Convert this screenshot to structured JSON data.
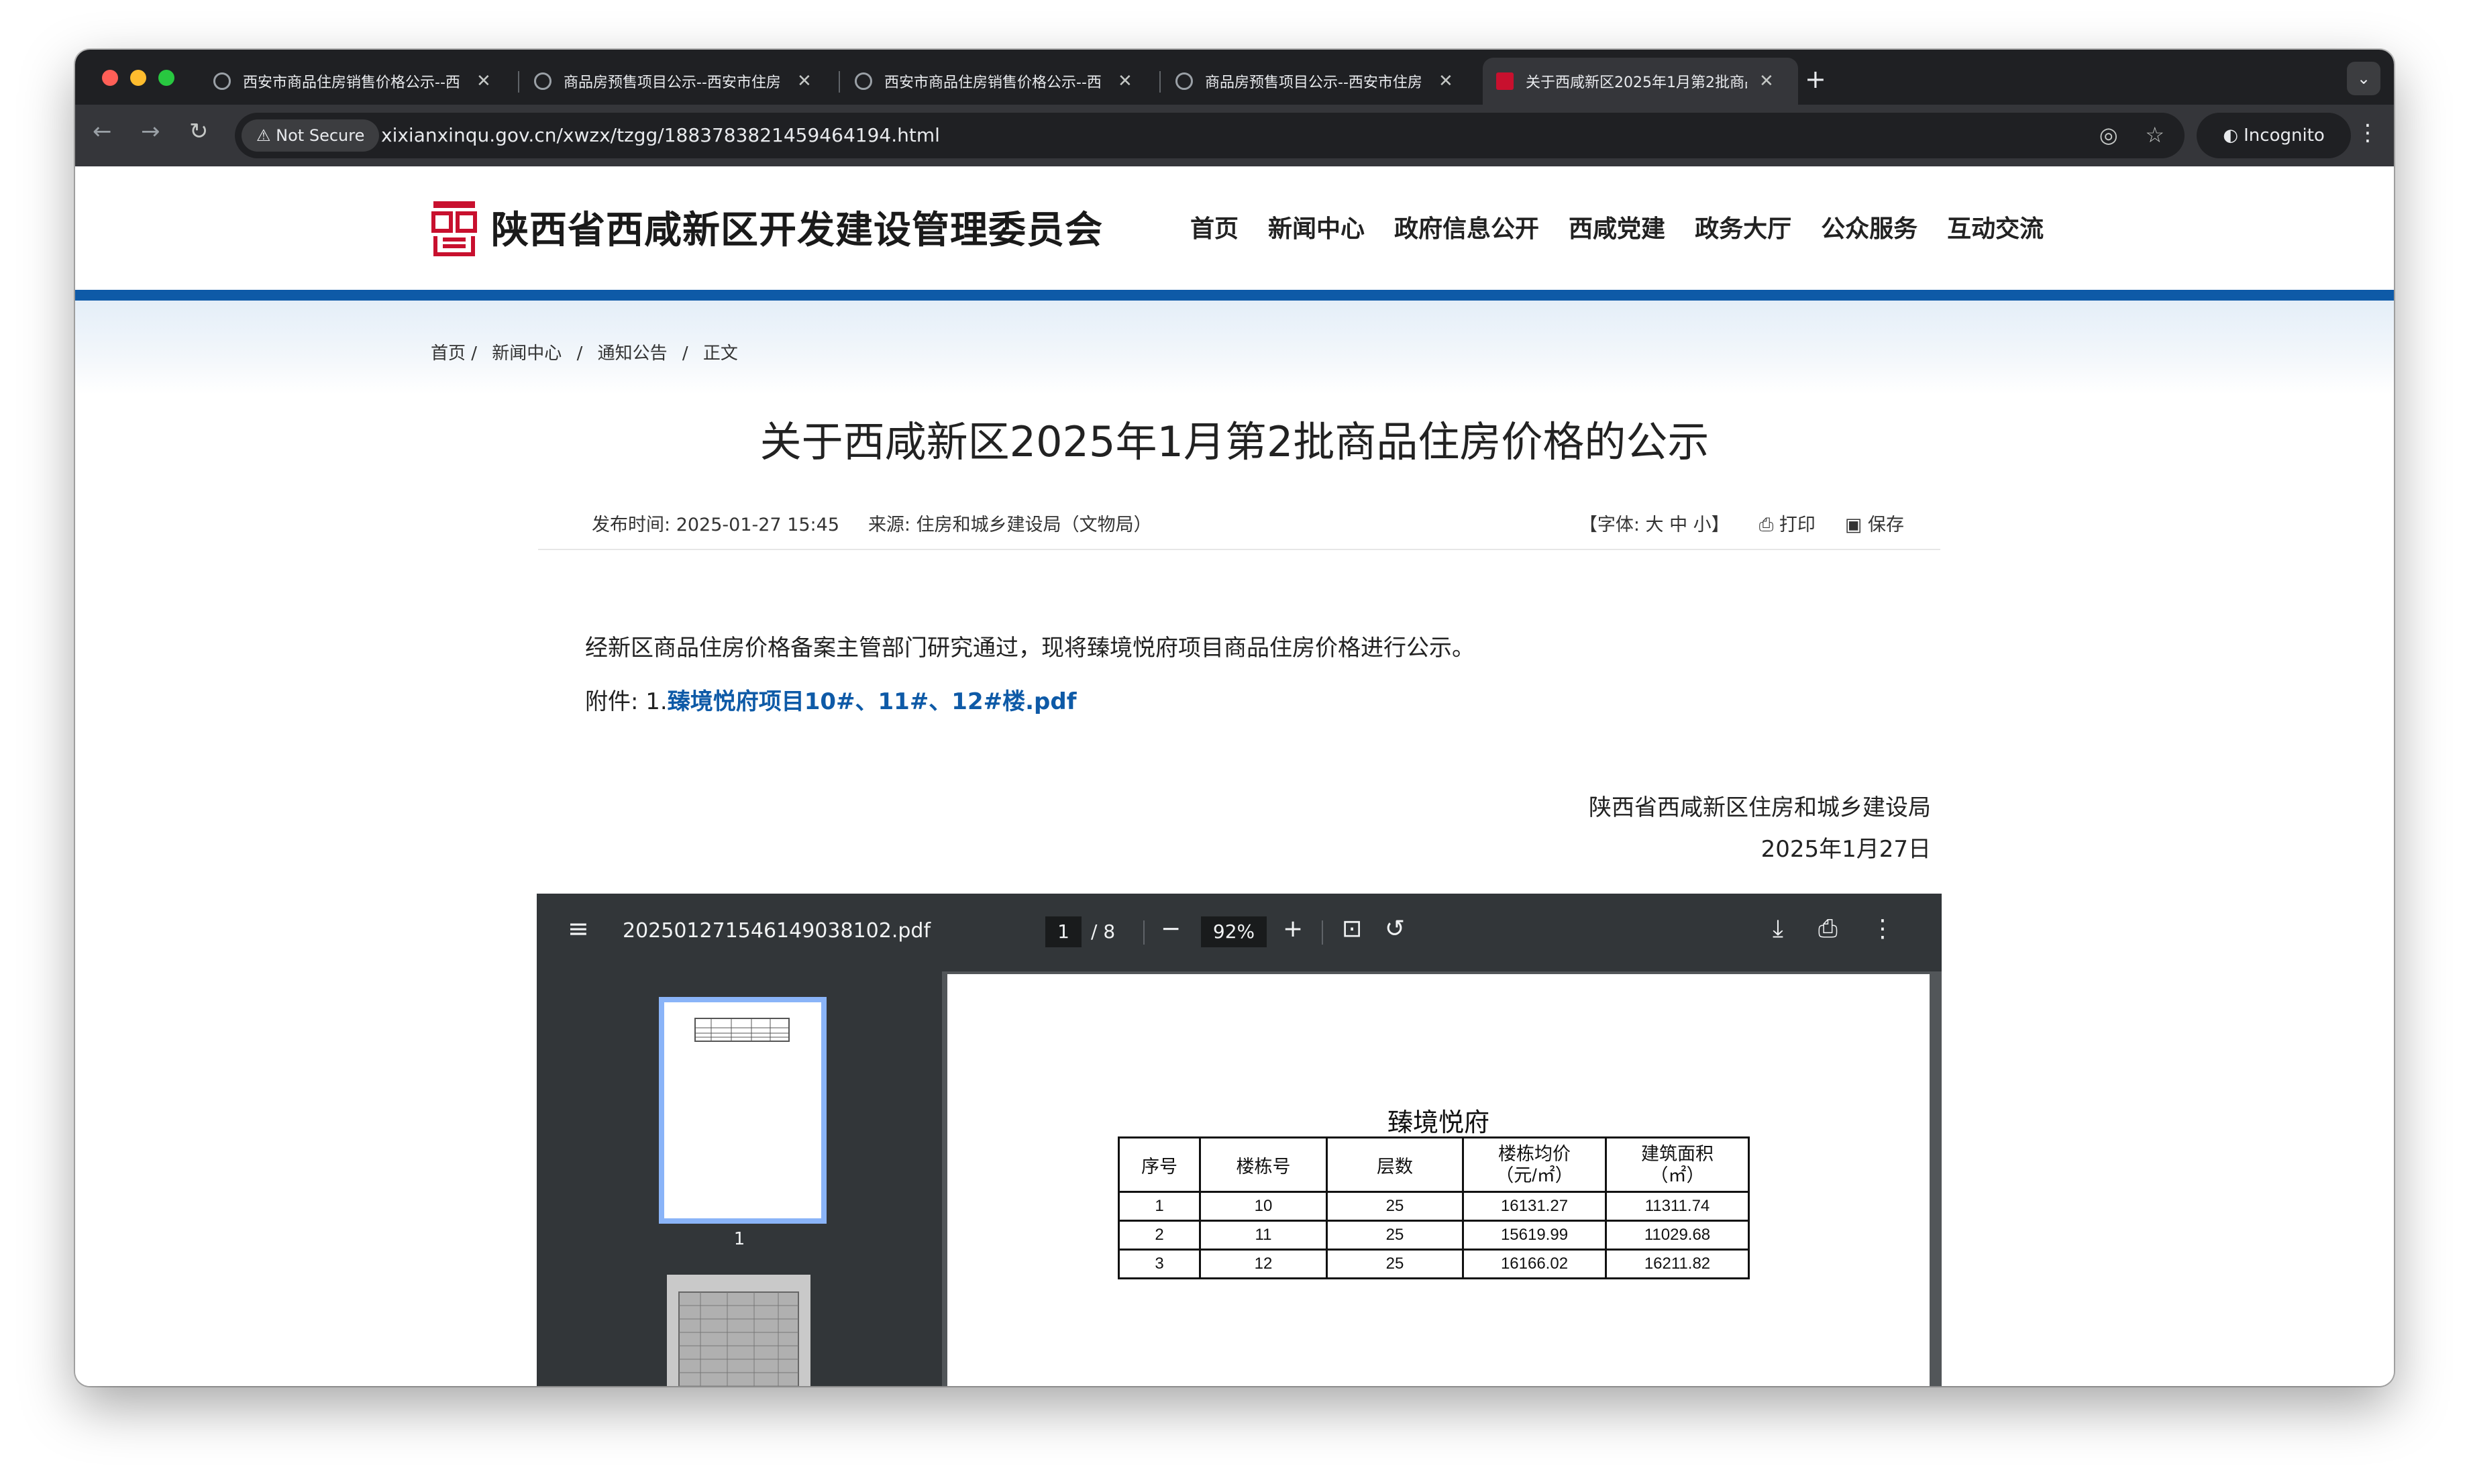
{
  "browser": {
    "tabs": [
      {
        "title": "西安市商品住房销售价格公示--西",
        "active": false
      },
      {
        "title": "商品房预售项目公示--西安市住房",
        "active": false
      },
      {
        "title": "西安市商品住房销售价格公示--西",
        "active": false
      },
      {
        "title": "商品房预售项目公示--西安市住房",
        "active": false
      },
      {
        "title": "关于西咸新区2025年1月第2批商品",
        "active": true
      }
    ],
    "security_label": "Not Secure",
    "url": "xixianxinqu.gov.cn/xwzx/tzgg/1883783821459464194.html",
    "incognito_label": "Incognito"
  },
  "site": {
    "name": "陕西省西咸新区开发建设管理委员会",
    "nav": [
      "首页",
      "新闻中心",
      "政府信息公开",
      "西咸党建",
      "政务大厅",
      "公众服务",
      "互动交流"
    ],
    "breadcrumb": [
      "首页 /",
      "新闻中心",
      "/",
      "通知公告",
      "/",
      "正文"
    ]
  },
  "article": {
    "title": "关于西咸新区2025年1月第2批商品住房价格的公示",
    "publish_label": "发布时间:",
    "publish_time": "2025-01-27 15:45",
    "source_label": "来源:",
    "source": "住房和城乡建设局（文物局）",
    "font_size_label": "【字体: 大 中 小】",
    "print_label": "打印",
    "save_label": "保存",
    "paragraph": "经新区商品住房价格备案主管部门研究通过，现将臻境悦府项目商品住房价格进行公示。",
    "attachment_label": "附件: 1.",
    "attachment_link": "臻境悦府项目10#、11#、12#楼.pdf",
    "signature_org": "陕西省西咸新区住房和城乡建设局",
    "signature_date": "2025年1月27日"
  },
  "pdf_viewer": {
    "filename": "20250127154614903810​2.pdf",
    "current_page": "1",
    "total_pages": "/ 8",
    "zoom": "92%",
    "thumb1_label": "1",
    "document": {
      "title": "臻境悦府",
      "headers": [
        "序号",
        "楼栋号",
        "层数",
        "楼栋均价\n（元/㎡）",
        "建筑面积\n（㎡）"
      ],
      "rows": [
        [
          "1",
          "10",
          "25",
          "16131.27",
          "11311.74"
        ],
        [
          "2",
          "11",
          "25",
          "15619.99",
          "11029.68"
        ],
        [
          "3",
          "12",
          "25",
          "16166.02",
          "16211.82"
        ]
      ]
    }
  },
  "colors": {
    "accent_blue": "#0e5aa7",
    "logo_red": "#c8102e",
    "browser_dark": "#1f2023"
  }
}
